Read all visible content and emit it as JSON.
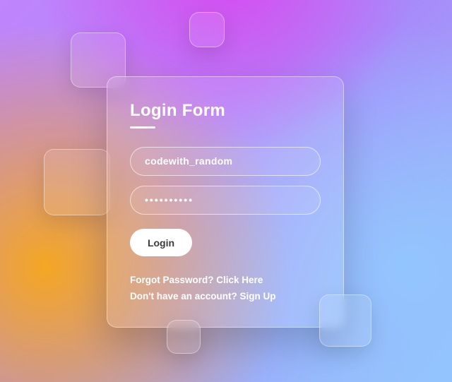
{
  "form": {
    "title": "Login Form",
    "username_value": "codewith_random",
    "password_value": "••••••••••",
    "login_label": "Login",
    "forgot_text": "Forgot Password? ",
    "forgot_action": "Click Here",
    "signup_text": "Don't have an account? ",
    "signup_action": "Sign Up"
  }
}
